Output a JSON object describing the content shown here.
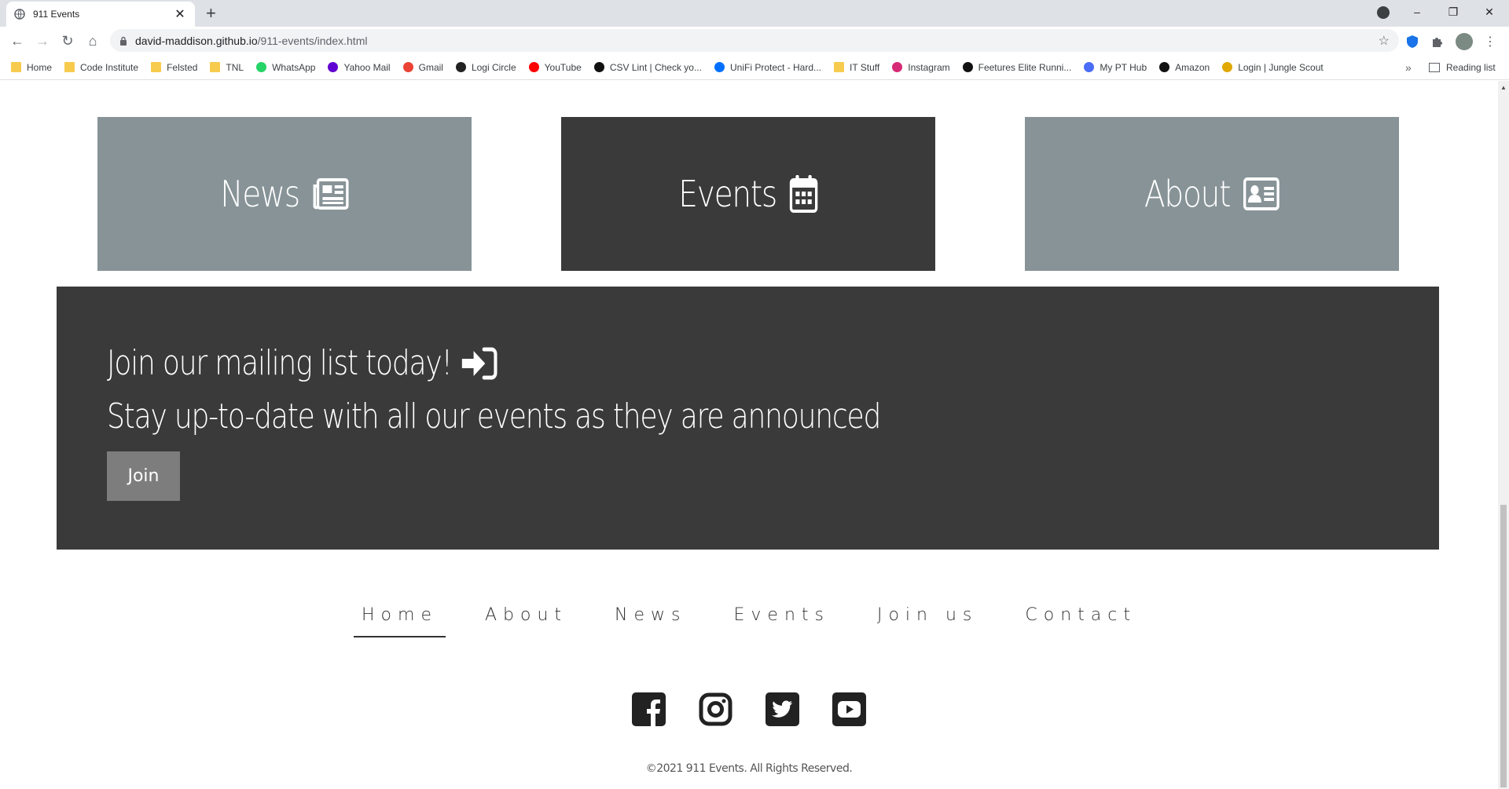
{
  "browser": {
    "tab_title": "911 Events",
    "url_host": "david-maddison.github.io",
    "url_path": "/911-events/index.html",
    "bookmarks": [
      {
        "label": "Home",
        "icon": "folder-icon"
      },
      {
        "label": "Code Institute",
        "icon": "folder-icon"
      },
      {
        "label": "Felsted",
        "icon": "folder-icon"
      },
      {
        "label": "TNL",
        "icon": "folder-icon"
      },
      {
        "label": "WhatsApp",
        "icon": "whatsapp-icon"
      },
      {
        "label": "Yahoo Mail",
        "icon": "yahoo-mail-icon"
      },
      {
        "label": "Gmail",
        "icon": "gmail-icon"
      },
      {
        "label": "Logi Circle",
        "icon": "logi-circle-icon"
      },
      {
        "label": "YouTube",
        "icon": "youtube-icon"
      },
      {
        "label": "CSV Lint | Check yo...",
        "icon": "csv-lint-icon"
      },
      {
        "label": "UniFi Protect - Hard...",
        "icon": "unifi-icon"
      },
      {
        "label": "IT Stuff",
        "icon": "folder-icon"
      },
      {
        "label": "Instagram",
        "icon": "instagram-icon"
      },
      {
        "label": "Feetures Elite Runni...",
        "icon": "feetures-icon"
      },
      {
        "label": "My PT Hub",
        "icon": "pt-hub-icon"
      },
      {
        "label": "Amazon",
        "icon": "amazon-icon"
      },
      {
        "label": "Login | Jungle Scout",
        "icon": "jungle-scout-icon"
      }
    ],
    "more_label": "»",
    "reading_list_label": "Reading list"
  },
  "tiles": [
    {
      "label": "News",
      "icon": "newspaper-icon",
      "color": "#879397"
    },
    {
      "label": "Events",
      "icon": "calendar-icon",
      "color": "#3a3a3a"
    },
    {
      "label": "About",
      "icon": "id-card-icon",
      "color": "#879397"
    }
  ],
  "mailing": {
    "heading": "Join our mailing list today!",
    "subheading": "Stay up-to-date with all our events as they are announced",
    "button_label": "Join"
  },
  "footer_nav": {
    "items": [
      "Home",
      "About",
      "News",
      "Events",
      "Join us",
      "Contact"
    ],
    "active": "Home"
  },
  "socials": [
    "facebook-icon",
    "instagram-icon",
    "twitter-icon",
    "youtube-icon"
  ],
  "copyright": "©2021 911 Events. All Rights Reserved."
}
